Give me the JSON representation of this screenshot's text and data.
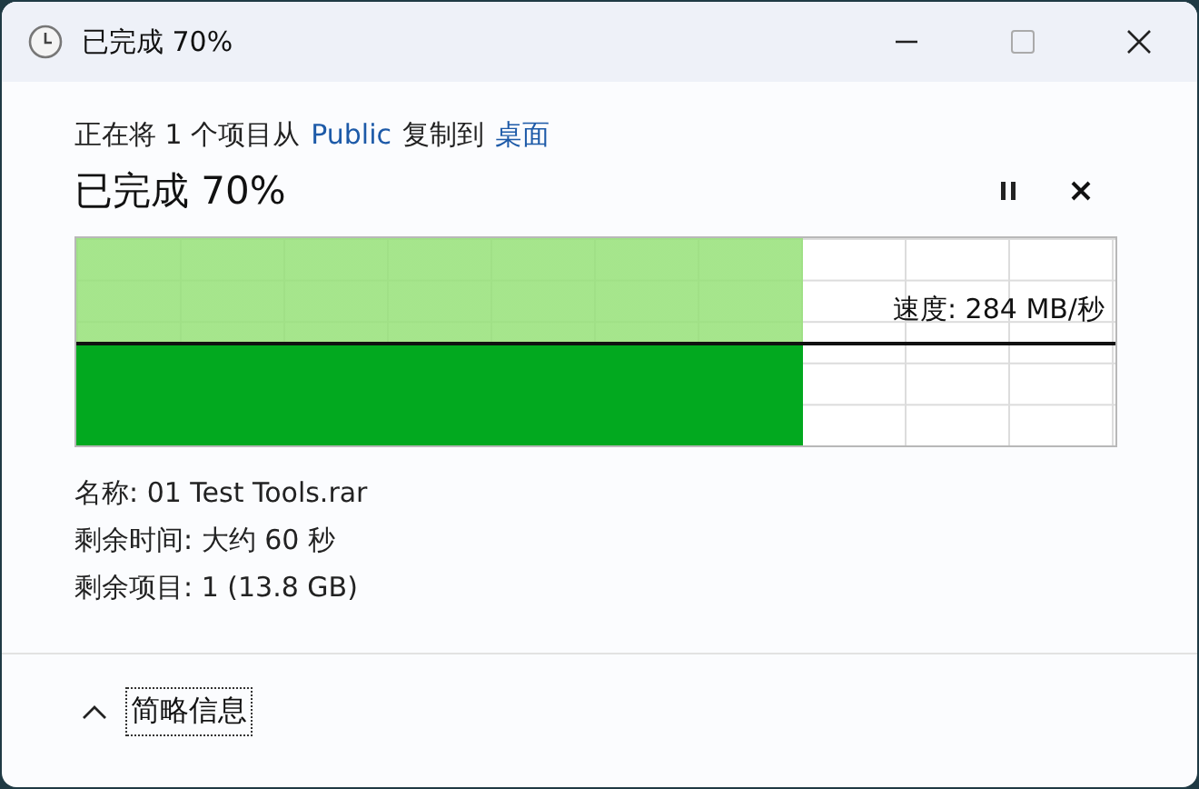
{
  "window": {
    "title": "已完成 70%"
  },
  "description": {
    "prefix": "正在将 1 个项目从",
    "source": "Public",
    "middle": "复制到",
    "destination": "桌面"
  },
  "heading": "已完成 70%",
  "progress": {
    "level": 0.7,
    "speed": "速度: 284 MB/秒"
  },
  "details": [
    "名称: 01 Test Tools.rar",
    "剩余时间: 大约 60 秒",
    "剩余项目: 1 (13.8 GB)"
  ],
  "footer": {
    "toggle": "简略信息",
    "expanded": true
  }
}
